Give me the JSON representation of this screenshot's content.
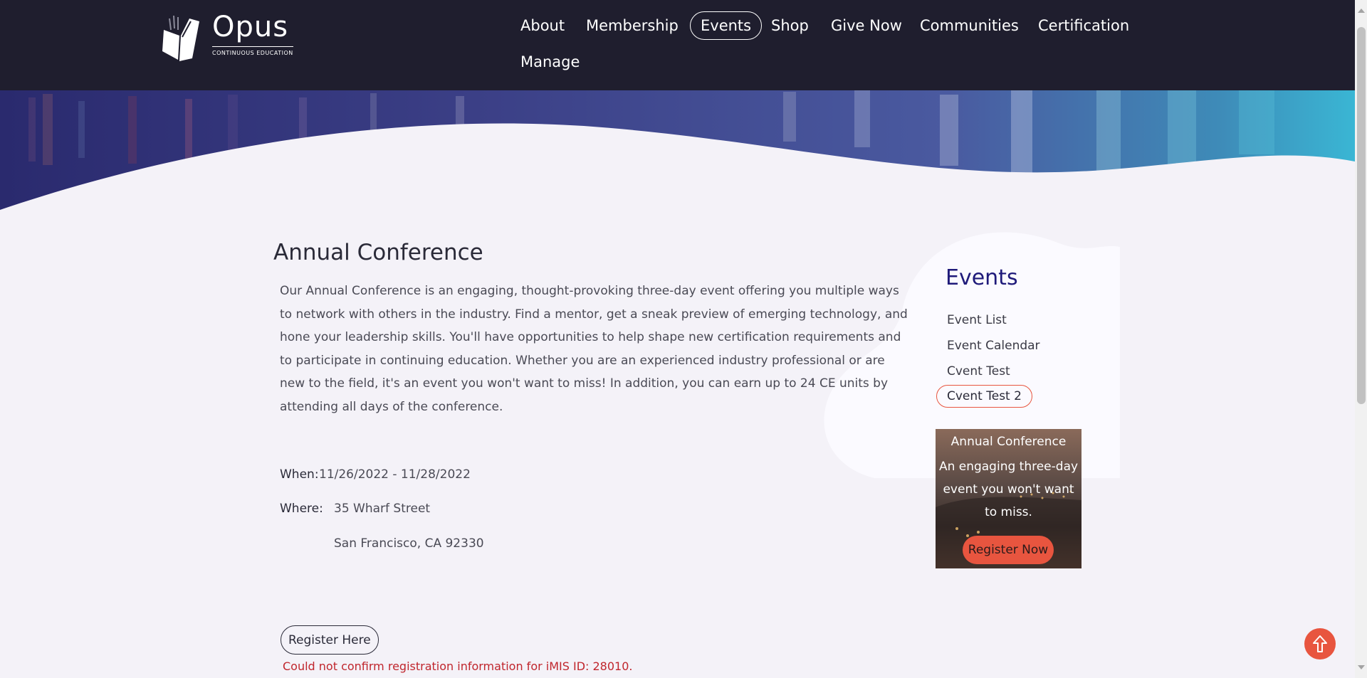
{
  "brand": {
    "name": "Opus",
    "tagline": "CONTINUOUS  EDUCATION"
  },
  "nav": {
    "items": [
      {
        "label": "About"
      },
      {
        "label": "Membership"
      },
      {
        "label": "Events",
        "active": true
      },
      {
        "label": "Shop"
      },
      {
        "label": "Give Now"
      },
      {
        "label": "Communities"
      },
      {
        "label": "Certification"
      },
      {
        "label": "Manage"
      }
    ]
  },
  "event": {
    "title": "Annual Conference",
    "description": "Our Annual Conference is an engaging, thought-provoking three-day event offering you multiple ways to network with others in the industry. Find a mentor, get a sneak preview of emerging technology, and hone your leadership skills. You'll have opportunities to help shape new certification requirements and to participate in continuing education. Whether you are an experienced industry professional or are new to the field, it's an event you won't want to miss! In addition, you can earn up to 24 CE units by attending all days of the conference.",
    "when_label": "When:",
    "when_value": "11/26/2022 - 11/28/2022",
    "where_label": "Where:",
    "address_line1": "35 Wharf Street",
    "address_line2": "San Francisco, CA  92330",
    "register_label": "Register Here",
    "error": "Could not confirm registration information for iMIS ID: 28010."
  },
  "sidebar": {
    "title": "Events",
    "links": [
      {
        "label": "Event List"
      },
      {
        "label": "Event Calendar"
      },
      {
        "label": "Cvent Test"
      },
      {
        "label": "Cvent Test 2",
        "active": true
      }
    ],
    "promo": {
      "title": "Annual Conference",
      "subtitle": "An engaging three-day event you won't want to miss.",
      "button": "Register Now"
    }
  },
  "colors": {
    "header_bg": "#1f1e2e",
    "page_bg": "#f4f2f8",
    "accent": "#e8553f",
    "sidebar_title": "#1f1a7a",
    "error": "#c0262d"
  },
  "icons": {
    "logo": "open-book-icon",
    "back_to_top": "arrow-up-icon"
  }
}
